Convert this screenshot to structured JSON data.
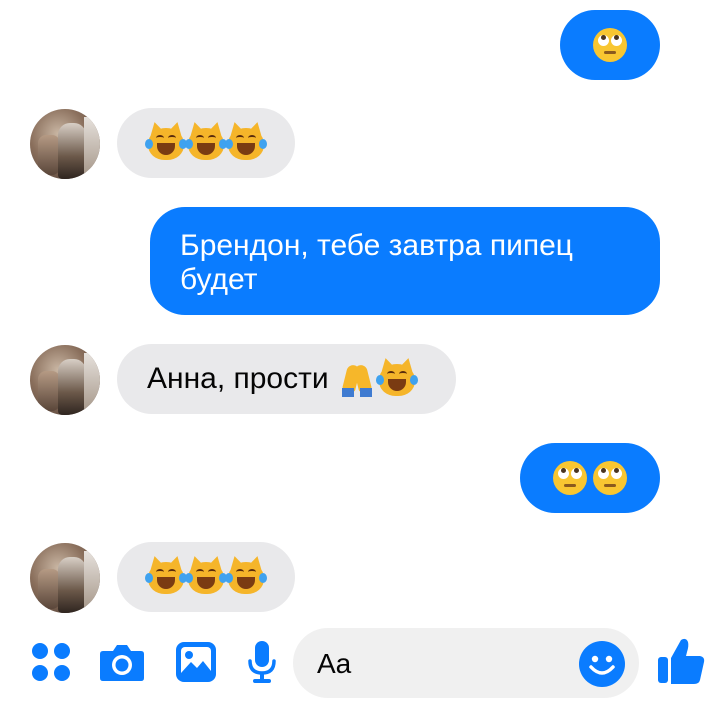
{
  "colors": {
    "outgoing_bubble": "#0a7cff",
    "incoming_bubble": "#e9e9eb",
    "accent_icons": "#0a7cff"
  },
  "messages": [
    {
      "direction": "outgoing",
      "type": "emoji",
      "emojis": [
        "rolling-eyes-emoji"
      ]
    },
    {
      "direction": "incoming",
      "type": "emoji",
      "emojis": [
        "cat-tears-of-joy-emoji",
        "cat-tears-of-joy-emoji",
        "cat-tears-of-joy-emoji"
      ]
    },
    {
      "direction": "outgoing",
      "type": "text",
      "text": "Брендон, тебе завтра пипец будет"
    },
    {
      "direction": "incoming",
      "type": "text",
      "text": "Анна, прости",
      "emojis": [
        "folded-hands-emoji",
        "cat-tears-of-joy-emoji"
      ]
    },
    {
      "direction": "outgoing",
      "type": "emoji",
      "emojis": [
        "rolling-eyes-emoji",
        "rolling-eyes-emoji"
      ]
    },
    {
      "direction": "incoming",
      "type": "emoji",
      "emojis": [
        "cat-tears-of-joy-emoji",
        "cat-tears-of-joy-emoji",
        "cat-tears-of-joy-emoji"
      ]
    }
  ],
  "composer": {
    "placeholder": "Aa",
    "icons": [
      "apps-icon",
      "camera-icon",
      "gallery-icon",
      "microphone-icon",
      "emoji-smile-icon",
      "thumbs-up-icon"
    ]
  }
}
